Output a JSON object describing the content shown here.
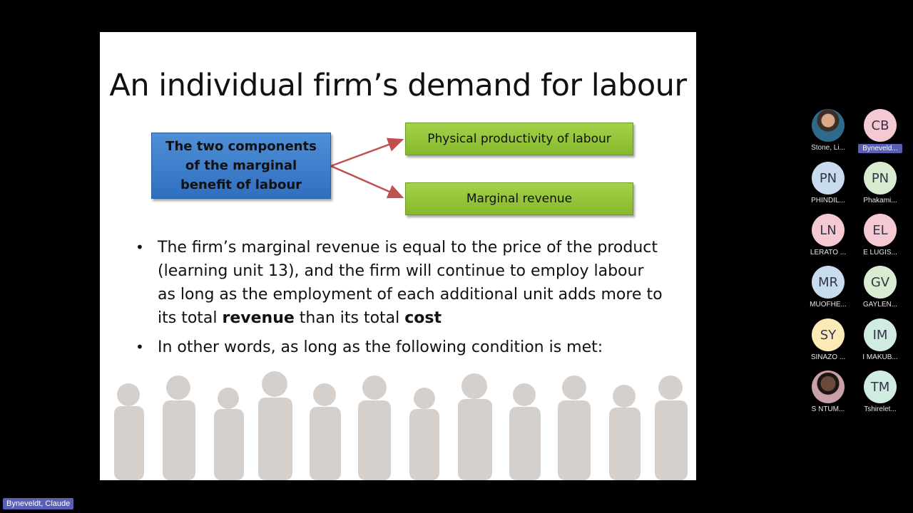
{
  "slide": {
    "title": "An individual firm’s demand for labour",
    "component_box": "The two components of the marginal benefit of labour",
    "box_physical": "Physical productivity of labour",
    "box_revenue": "Marginal revenue",
    "bullet1": {
      "part1": "The firm’s marginal revenue is equal to the price of the product (learning unit 13), and the firm will continue to employ labour as long as the employment of each additional unit adds more to its total ",
      "bold1": "revenue",
      "part2": " than its total ",
      "bold2": "cost"
    },
    "bullet2": "In other words, as long as the following condition is met:",
    "bullet_glyph": "•",
    "colors": {
      "blue_box": "#3a7cc8",
      "green_box": "#92c43a",
      "arrow": "#c0504d"
    }
  },
  "participants": [
    {
      "initials": "",
      "name": "Stone, Li...",
      "avatar_color": "#4a7a9c",
      "icon": "user-photo-icon"
    },
    {
      "initials": "CB",
      "name": "Byneveld...",
      "avatar_color": "#f5c9d2",
      "active": true
    },
    {
      "initials": "PN",
      "name": "PHINDIL...",
      "avatar_color": "#c9dcef"
    },
    {
      "initials": "PN",
      "name": "Phakami...",
      "avatar_color": "#d9ecd2"
    },
    {
      "initials": "LN",
      "name": "LERATO ...",
      "avatar_color": "#f5c9d2"
    },
    {
      "initials": "EL",
      "name": "E LUGIS...",
      "avatar_color": "#f5c9d2"
    },
    {
      "initials": "MR",
      "name": "MUOFHE...",
      "avatar_color": "#c9dcef"
    },
    {
      "initials": "GV",
      "name": "GAYLEN...",
      "avatar_color": "#d9ecd2"
    },
    {
      "initials": "SY",
      "name": "SINAZO ...",
      "avatar_color": "#fbe9b8"
    },
    {
      "initials": "IM",
      "name": "I MAKUB...",
      "avatar_color": "#d0ebe0"
    },
    {
      "initials": "",
      "name": "S NTUM...",
      "avatar_color": "#6b4a3a",
      "icon": "user-photo-icon"
    },
    {
      "initials": "TM",
      "name": "Tshirelet...",
      "avatar_color": "#d0ebe0"
    }
  ],
  "speaker_name": "Byneveldt, Claude"
}
